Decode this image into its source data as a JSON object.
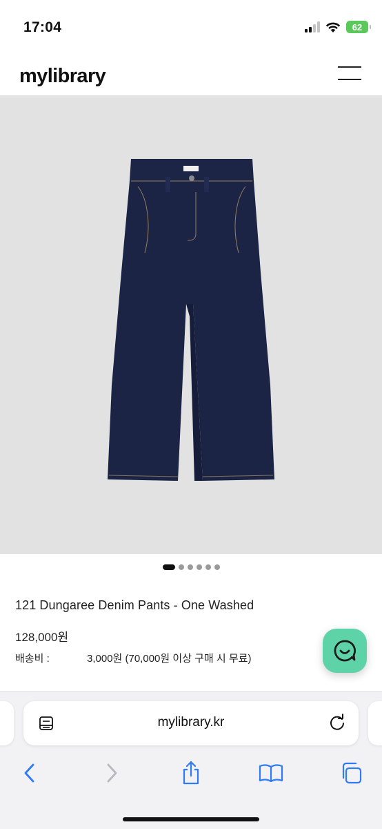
{
  "status_bar": {
    "time": "17:04",
    "battery": "62",
    "battery_color": "#5ac85a"
  },
  "header": {
    "logo": "mylibrary",
    "menu_icon": "hamburger-menu-icon"
  },
  "gallery": {
    "image_description_icon": "denim-pants-photo",
    "background_color": "#e2e2e2",
    "slide_count": 6,
    "active_slide": 1
  },
  "product": {
    "name": "121 Dungaree Denim Pants - One Washed",
    "price": "128,000원",
    "shipping_label": "배송비 :",
    "shipping_value": "3,000원 (70,000원 이상 구매 시 무료)"
  },
  "chat": {
    "icon": "chat-bubble-icon",
    "color": "#5fd3a8"
  },
  "browser": {
    "url": "mylibrary.kr",
    "accent_color": "#2f7bf6",
    "icons": {
      "reader": "reader-mode-icon",
      "reload": "reload-icon",
      "back": "back-arrow-icon",
      "forward": "forward-arrow-icon",
      "share": "share-icon",
      "bookmarks": "bookmarks-icon",
      "tabs": "tabs-icon"
    }
  }
}
